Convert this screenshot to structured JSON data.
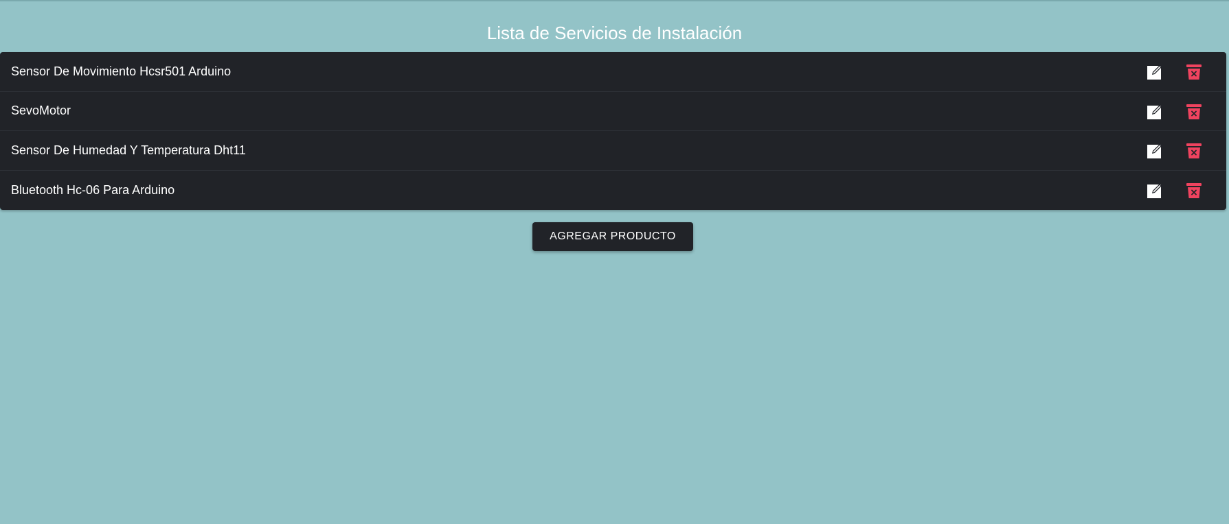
{
  "page": {
    "title": "Lista de Servicios de Instalación"
  },
  "services": [
    {
      "name": "Sensor De Movimiento Hcsr501 Arduino"
    },
    {
      "name": "SevoMotor"
    },
    {
      "name": "Sensor De Humedad Y Temperatura Dht11"
    },
    {
      "name": "Bluetooth Hc-06 Para Arduino"
    }
  ],
  "actions": {
    "add_label": "AGREGAR PRODUCTO",
    "edit_icon": "edit-icon",
    "delete_icon": "trash-icon"
  },
  "colors": {
    "background": "#93c3c7",
    "list_background": "#212328",
    "delete_accent": "#f0435f",
    "text": "#ffffff"
  }
}
